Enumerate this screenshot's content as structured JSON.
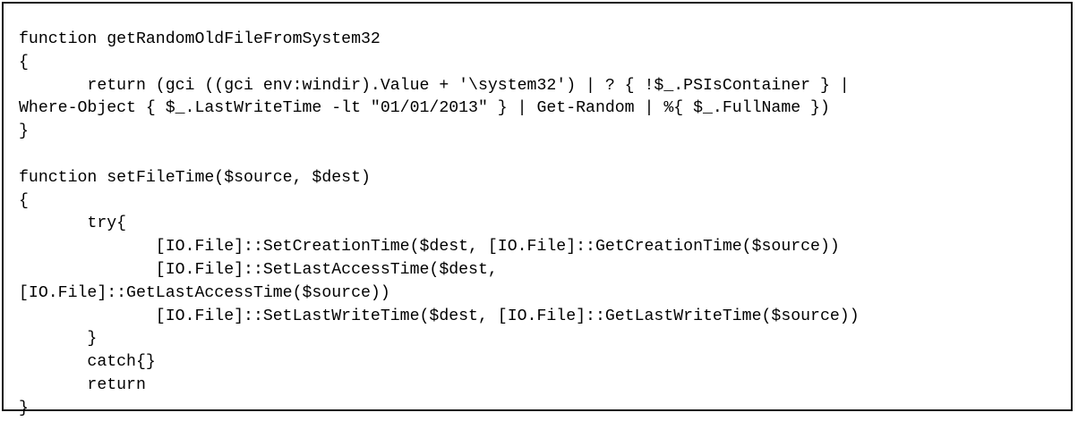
{
  "code": {
    "lines": [
      "function getRandomOldFileFromSystem32",
      "{",
      "       return (gci ((gci env:windir).Value + '\\system32') | ? { !$_.PSIsContainer } |",
      "Where-Object { $_.LastWriteTime -lt \"01/01/2013\" } | Get-Random | %{ $_.FullName })",
      "}",
      "",
      "function setFileTime($source, $dest)",
      "{",
      "       try{",
      "              [IO.File]::SetCreationTime($dest, [IO.File]::GetCreationTime($source))",
      "              [IO.File]::SetLastAccessTime($dest,",
      "[IO.File]::GetLastAccessTime($source))",
      "              [IO.File]::SetLastWriteTime($dest, [IO.File]::GetLastWriteTime($source))",
      "       }",
      "       catch{}",
      "       return",
      "}"
    ]
  }
}
